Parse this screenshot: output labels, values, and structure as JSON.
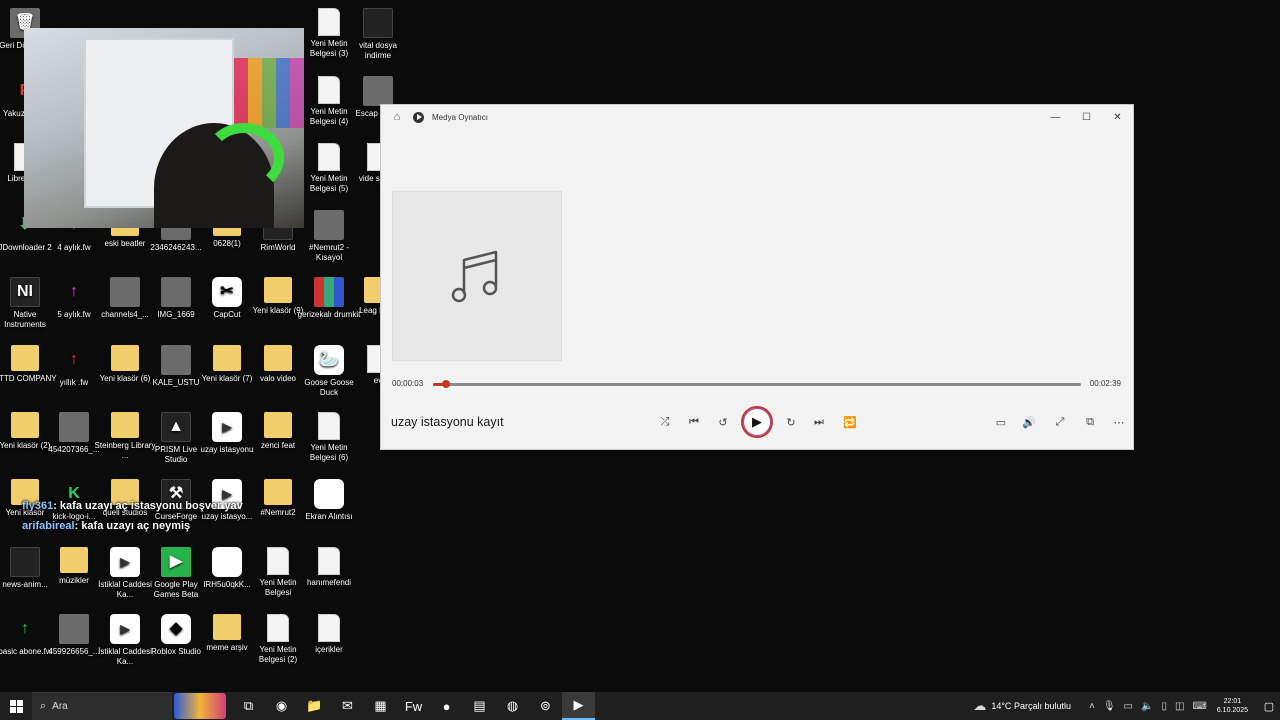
{
  "desktop": {
    "icons": [
      {
        "label": "Geri Dönüşüm",
        "glyph": "🗑",
        "cls": "g-img"
      },
      {
        "label": "Yakuza tung",
        "glyph": "P",
        "cls": "g-red"
      },
      {
        "label": "LibreO 25",
        "glyph": "",
        "cls": "g-doc"
      },
      {
        "label": "JDownloader 2",
        "glyph": "⬇",
        "cls": "g-green"
      },
      {
        "label": "4 aylık.fw",
        "glyph": "↑",
        "cls": "g-green"
      },
      {
        "label": "eski beatler",
        "glyph": "",
        "cls": "g-folder"
      },
      {
        "label": "2346246243...",
        "glyph": "",
        "cls": "g-img"
      },
      {
        "label": "0628(1)",
        "glyph": "",
        "cls": "g-folder"
      },
      {
        "label": "RimWorld",
        "glyph": "",
        "cls": "g-dark"
      },
      {
        "label": "#Nemrut2 - Kısayol",
        "glyph": "",
        "cls": "g-img"
      },
      {
        "label": "Native Instruments",
        "glyph": "NI",
        "cls": "g-dark"
      },
      {
        "label": "5 aylık.fw",
        "glyph": "↑",
        "cls": "g-pink"
      },
      {
        "label": "channels4_...",
        "glyph": "",
        "cls": "g-img"
      },
      {
        "label": "IMG_1669",
        "glyph": "",
        "cls": "g-img"
      },
      {
        "label": "CapCut",
        "glyph": "✂",
        "cls": "g-white"
      },
      {
        "label": "Yeni klasör (9)",
        "glyph": "",
        "cls": "g-folder"
      },
      {
        "label": "gerizekalı drumkit",
        "glyph": "",
        "cls": "g-rar"
      },
      {
        "label": "RTTD COMPANY",
        "glyph": "",
        "cls": "g-folder"
      },
      {
        "label": "yıllık .fw",
        "glyph": "↑",
        "cls": "g-red"
      },
      {
        "label": "Yeni klasör (6)",
        "glyph": "",
        "cls": "g-folder"
      },
      {
        "label": "KALE_USTU",
        "glyph": "",
        "cls": "g-img"
      },
      {
        "label": "Yeni klasör (7)",
        "glyph": "",
        "cls": "g-folder"
      },
      {
        "label": "valo video",
        "glyph": "",
        "cls": "g-folder"
      },
      {
        "label": "Goose Goose Duck",
        "glyph": "🦢",
        "cls": "g-white"
      },
      {
        "label": "Yeni klasör (2)",
        "glyph": "",
        "cls": "g-folder"
      },
      {
        "label": "454207366_...",
        "glyph": "",
        "cls": "g-img"
      },
      {
        "label": "Steinberg Library ...",
        "glyph": "",
        "cls": "g-folder"
      },
      {
        "label": "PRISM Live Studio",
        "glyph": "▲",
        "cls": "g-dark"
      },
      {
        "label": "uzay istasyonu",
        "glyph": "▶",
        "cls": "g-media"
      },
      {
        "label": "zenci feat",
        "glyph": "",
        "cls": "g-folder"
      },
      {
        "label": "Yeni Metin Belgesi (6)",
        "glyph": "",
        "cls": "g-doc"
      },
      {
        "label": "Yeni klasör",
        "glyph": "",
        "cls": "g-folder"
      },
      {
        "label": "kick-logo-i...",
        "glyph": "K",
        "cls": "g-green"
      },
      {
        "label": "quell studios",
        "glyph": "",
        "cls": "g-folder"
      },
      {
        "label": "CurseForge",
        "glyph": "⚒",
        "cls": "g-dark"
      },
      {
        "label": "uzay istasyo...",
        "glyph": "▶",
        "cls": "g-media"
      },
      {
        "label": "#Nemrut2",
        "glyph": "",
        "cls": "g-folder"
      },
      {
        "label": "Ekran Alıntısı",
        "glyph": "",
        "cls": "g-white"
      },
      {
        "label": "news-anim...",
        "glyph": "",
        "cls": "g-dark"
      },
      {
        "label": "müzikler",
        "glyph": "",
        "cls": "g-folder"
      },
      {
        "label": "İstiklal Caddesi Ka...",
        "glyph": "▶",
        "cls": "g-media"
      },
      {
        "label": "Google Play Games Beta",
        "glyph": "▶",
        "cls": "g-gplay"
      },
      {
        "label": "IRH5u0qkK...",
        "glyph": "",
        "cls": "g-white"
      },
      {
        "label": "Yeni Metin Belgesi",
        "glyph": "",
        "cls": "g-doc"
      },
      {
        "label": "hanımefendi",
        "glyph": "",
        "cls": "g-doc"
      },
      {
        "label": "basic abone.fw",
        "glyph": "↑",
        "cls": "g-green"
      },
      {
        "label": "459926656_...",
        "glyph": "",
        "cls": "g-img"
      },
      {
        "label": "İstiklal Caddesi Ka...",
        "glyph": "▶",
        "cls": "g-media"
      },
      {
        "label": "Roblox Studio",
        "glyph": "◆",
        "cls": "g-white"
      },
      {
        "label": "meme arşiv",
        "glyph": "",
        "cls": "g-folder"
      },
      {
        "label": "Yeni Metin Belgesi (2)",
        "glyph": "",
        "cls": "g-doc"
      },
      {
        "label": "içerikler",
        "glyph": "",
        "cls": "g-doc"
      },
      {
        "label": "Yeni Metin Belgesi (3)",
        "glyph": "",
        "cls": "g-doc"
      },
      {
        "label": "vital dosya indirme",
        "glyph": "",
        "cls": "g-dark"
      },
      {
        "label": "Yeni Metin Belgesi (4)",
        "glyph": "",
        "cls": "g-doc"
      },
      {
        "label": "Escap Backr",
        "glyph": "",
        "cls": "g-img"
      },
      {
        "label": "Yeni Metin Belgesi (5)",
        "glyph": "",
        "cls": "g-doc"
      },
      {
        "label": "vide sesler",
        "glyph": "",
        "cls": "g-doc"
      },
      {
        "label": "Leag Lege",
        "glyph": "",
        "cls": "g-folder"
      },
      {
        "label": "ev",
        "glyph": "",
        "cls": "g-doc"
      }
    ]
  },
  "chat": [
    {
      "user": "fly361",
      "message": ": kafa uzayı aç istasyonu boşver yav"
    },
    {
      "user": "arifabireal",
      "message": ": kafa uzayı aç neymiş"
    }
  ],
  "player": {
    "app_title": "Medya Oynatıcı",
    "song_title": "uzay istasyonu kayıt",
    "time_current": "00:00:03",
    "time_total": "00:02:39",
    "progress_fraction": 0.02,
    "icons": {
      "home": "⌂",
      "minimize": "—",
      "maximize": "☐",
      "close": "✕",
      "shuffle": "⤮",
      "previous": "⏮",
      "rewind": "↺",
      "play": "▶",
      "forward": "↻",
      "next": "⏭",
      "repeat": "🔁",
      "captions": "▭",
      "volume": "🔊",
      "fullscreen": "⤢",
      "miniplayer": "⧉",
      "more": "⋯"
    },
    "accent_color": "#c7361e"
  },
  "taskbar": {
    "search_placeholder": "Ara",
    "apps": [
      "⧉",
      "◉",
      "📁",
      "✉",
      "▦",
      "Fw",
      "●",
      "▤",
      "◍",
      "⊚",
      "▶"
    ],
    "weather_temp": "14°C",
    "weather_text": "Parçalı bulutlu",
    "time": "22:01",
    "date": "6.10.2025"
  }
}
